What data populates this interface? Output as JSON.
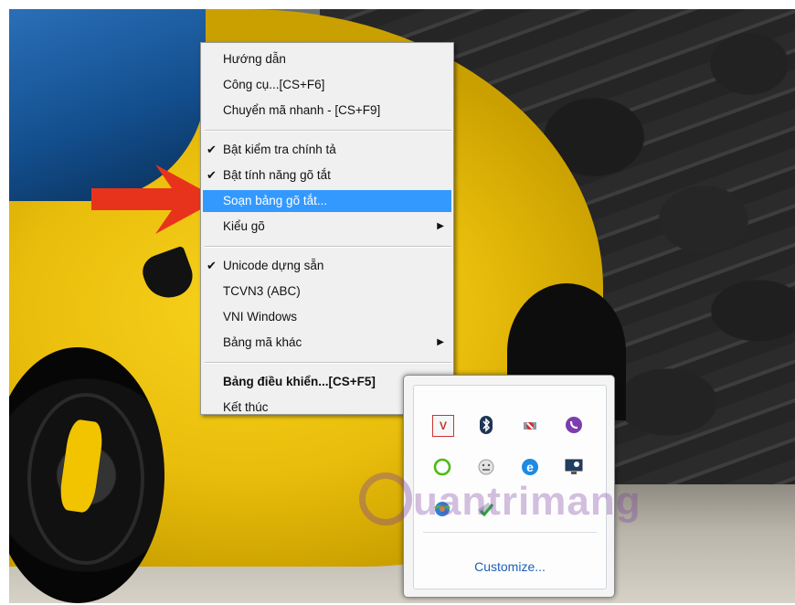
{
  "context_menu": {
    "items": [
      {
        "label": "Hướng dẫn"
      },
      {
        "label": "Công cụ...[CS+F6]"
      },
      {
        "label": "Chuyển mã nhanh - [CS+F9]"
      },
      {
        "label": "Bật kiểm tra chính tả",
        "checked": true
      },
      {
        "label": "Bật tính năng gõ tắt",
        "checked": true
      },
      {
        "label": "Soạn bảng gõ tắt...",
        "highlighted": true
      },
      {
        "label": "Kiểu gõ",
        "submenu": true
      },
      {
        "label": "Unicode dựng sẵn",
        "checked": true
      },
      {
        "label": "TCVN3 (ABC)"
      },
      {
        "label": "VNI Windows"
      },
      {
        "label": "Bảng mã khác",
        "submenu": true
      },
      {
        "label": "Bảng điều khiển...[CS+F5]",
        "bold": true
      },
      {
        "label": "Kết thúc"
      }
    ],
    "check_glyph": "✔",
    "submenu_glyph": "▶",
    "highlight_color": "#3399ff"
  },
  "tray_popup": {
    "customize_label": "Customize...",
    "icons": [
      "unikey-icon",
      "bluetooth-icon",
      "network-icon",
      "viber-icon",
      "green-app-icon",
      "smiley-icon",
      "ie-icon",
      "monitor-icon",
      "globe-icon",
      "usb-icon"
    ]
  },
  "watermark": {
    "text": "uantrimang"
  },
  "accent_arrow_color": "#e8331c"
}
